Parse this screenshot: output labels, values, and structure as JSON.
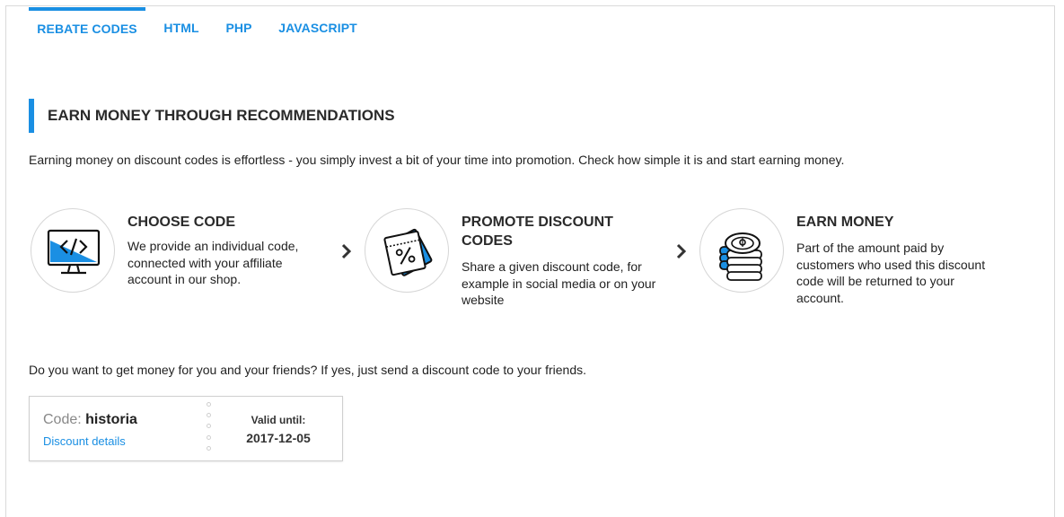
{
  "tabs": [
    {
      "label": "REBATE CODES",
      "active": true
    },
    {
      "label": "HTML",
      "active": false
    },
    {
      "label": "PHP",
      "active": false
    },
    {
      "label": "JAVASCRIPT",
      "active": false
    }
  ],
  "section": {
    "title": "EARN MONEY THROUGH RECOMMENDATIONS",
    "intro": "Earning money on discount codes is effortless - you simply invest a bit of your time into promotion. Check how simple it is and start earning money."
  },
  "steps": [
    {
      "title": "CHOOSE CODE",
      "text": "We provide an individual code, connected with your affiliate account in our shop.",
      "icon": "monitor-code-icon"
    },
    {
      "title": "PROMOTE DISCOUNT CODES",
      "text": "Share a given discount code, for example in social media or on your website",
      "icon": "discount-tickets-icon"
    },
    {
      "title": "EARN MONEY",
      "text": "Part of the amount paid by customers who used this discount code will be returned to your account.",
      "icon": "coins-icon"
    }
  ],
  "question": "Do you want to get money for you and your friends? If yes, just send a discount code to your friends.",
  "coupon": {
    "code_label": "Code:",
    "code_value": "historia",
    "details_link": "Discount details",
    "valid_label": "Valid until:",
    "valid_date": "2017-12-05"
  },
  "colors": {
    "accent": "#1a8fe3",
    "text": "#222222",
    "border": "#cfcfcf"
  }
}
